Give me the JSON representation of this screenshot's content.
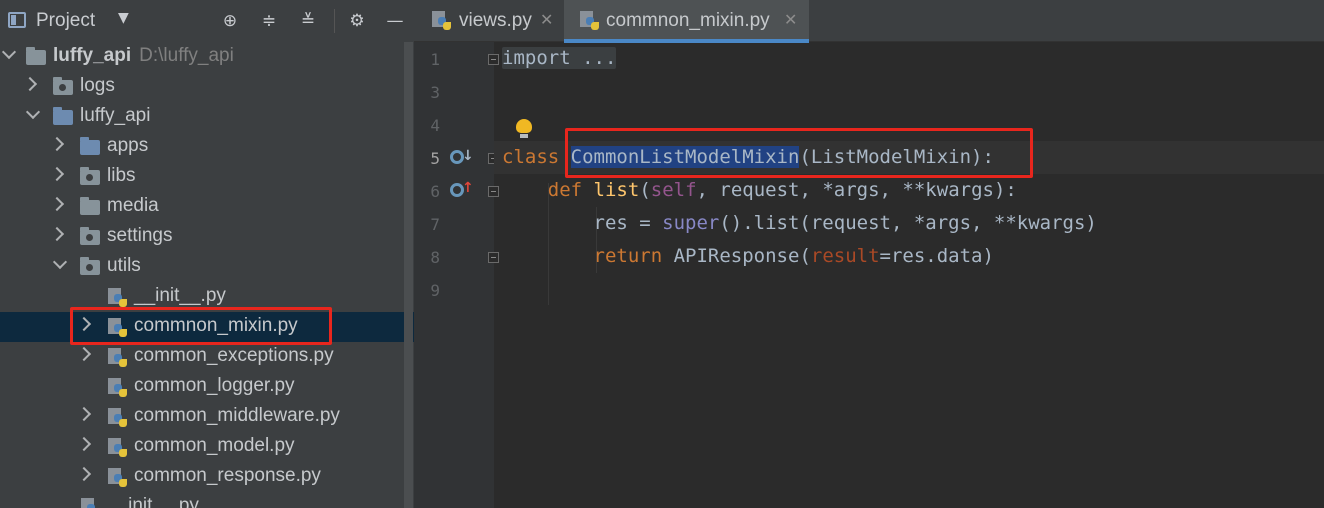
{
  "project_panel": {
    "title": "Project",
    "toolbar_icons": [
      "dropdown-caret-icon",
      "locate-icon",
      "expand-all-icon",
      "collapse-all-icon",
      "gear-icon",
      "minimize-icon"
    ],
    "tree": [
      {
        "label": "luffy_api",
        "sub": "D:\\luffy_api",
        "type": "folder",
        "expanded": true,
        "depth": 0
      },
      {
        "label": "logs",
        "type": "folder",
        "expanded": false,
        "depth": 1
      },
      {
        "label": "luffy_api",
        "type": "folder",
        "expanded": true,
        "depth": 1
      },
      {
        "label": "apps",
        "type": "folder",
        "expanded": false,
        "depth": 2
      },
      {
        "label": "libs",
        "type": "folder",
        "expanded": false,
        "depth": 2
      },
      {
        "label": "media",
        "type": "folder",
        "expanded": false,
        "depth": 2
      },
      {
        "label": "settings",
        "type": "folder",
        "expanded": false,
        "depth": 2
      },
      {
        "label": "utils",
        "type": "folder",
        "expanded": true,
        "depth": 2
      },
      {
        "label": "__init__.py",
        "type": "file",
        "depth": 3
      },
      {
        "label": "commnon_mixin.py",
        "type": "file",
        "depth": 3,
        "selected": true
      },
      {
        "label": "common_exceptions.py",
        "type": "file",
        "depth": 3
      },
      {
        "label": "common_logger.py",
        "type": "file",
        "depth": 3
      },
      {
        "label": "common_middleware.py",
        "type": "file",
        "depth": 3
      },
      {
        "label": "common_model.py",
        "type": "file",
        "depth": 3
      },
      {
        "label": "common_response.py",
        "type": "file",
        "depth": 3
      },
      {
        "label": "__init__.py",
        "type": "file",
        "depth": 2
      }
    ]
  },
  "editor": {
    "tabs": [
      {
        "label": "views.py",
        "close": "✕",
        "active": false
      },
      {
        "label": "commnon_mixin.py",
        "close": "✕",
        "active": true
      }
    ],
    "line_numbers": [
      "1",
      "3",
      "4",
      "5",
      "6",
      "7",
      "8",
      "9"
    ],
    "code": {
      "l1_folded": "import ...",
      "l5_class_kw": "class",
      "l5_class_name": "CommonListModelMixin",
      "l5_rest": "(ListModelMixin):",
      "l6_def": "def",
      "l6_fn": "list",
      "l6_open": "(",
      "l6_self": "self",
      "l6_rest": ", request, *args, **kwargs):",
      "l7": "res = super().list(request, *args, **kwargs)",
      "l8_return": "return",
      "l8_call": "APIResponse(",
      "l8_param": "result",
      "l8_rest": "=res.data)"
    },
    "highlight_color": "#e8261d"
  }
}
